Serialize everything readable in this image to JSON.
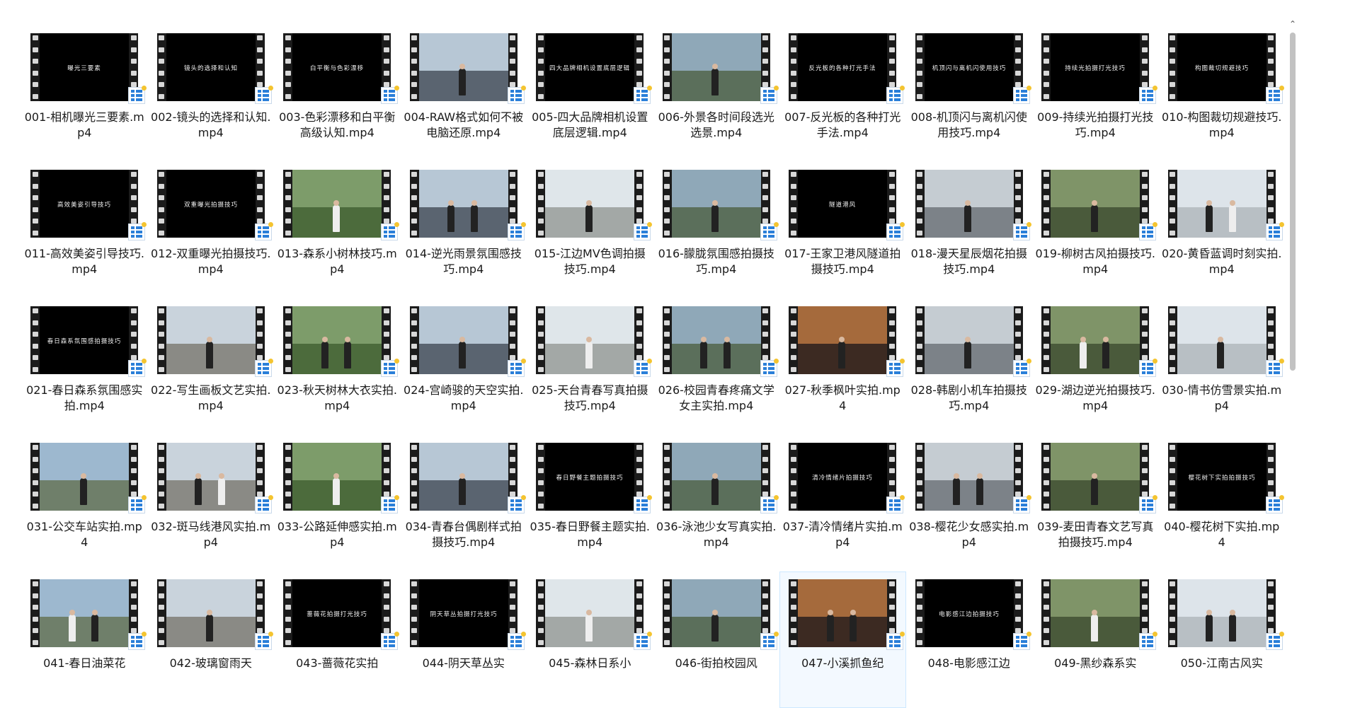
{
  "files": [
    {
      "name": "001-相机曝光三要素.mp4",
      "caption": "曝光三要素"
    },
    {
      "name": "002-镜头的选择和认知.mp4",
      "caption": "镜头的选择和认知"
    },
    {
      "name": "003-色彩漂移和白平衡高级认知.mp4",
      "caption": "白平衡与色彩漂移"
    },
    {
      "name": "004-RAW格式如何不被电脑还原.mp4",
      "caption": ""
    },
    {
      "name": "005-四大品牌相机设置底层逻辑.mp4",
      "caption": "四大品牌相机设置底层逻辑"
    },
    {
      "name": "006-外景各时间段选光选景.mp4",
      "caption": ""
    },
    {
      "name": "007-反光板的各种打光手法.mp4",
      "caption": "反光板的各种打光手法"
    },
    {
      "name": "008-机顶闪与离机闪使用技巧.mp4",
      "caption": "机顶闪与离机闪使用技巧"
    },
    {
      "name": "009-持续光拍摄打光技巧.mp4",
      "caption": "持续光拍摄打光技巧"
    },
    {
      "name": "010-构图裁切规避技巧.mp4",
      "caption": "构图裁切规避技巧"
    },
    {
      "name": "011-高效美姿引导技巧.mp4",
      "caption": "高效美姿引导技巧"
    },
    {
      "name": "012-双重曝光拍摄技巧.mp4",
      "caption": "双重曝光拍摄技巧"
    },
    {
      "name": "013-森系小树林技巧.mp4",
      "caption": ""
    },
    {
      "name": "014-逆光雨景氛围感技巧.mp4",
      "caption": ""
    },
    {
      "name": "015-江边MV色调拍摄技巧.mp4",
      "caption": ""
    },
    {
      "name": "016-朦胧氛围感拍摄技巧.mp4",
      "caption": ""
    },
    {
      "name": "017-王家卫港风隧道拍摄技巧.mp4",
      "caption": "隧道港风"
    },
    {
      "name": "018-漫天星辰烟花拍摄技巧.mp4",
      "caption": ""
    },
    {
      "name": "019-柳树古风拍摄技巧.mp4",
      "caption": ""
    },
    {
      "name": "020-黄昏蓝调时刻实拍.mp4",
      "caption": ""
    },
    {
      "name": "021-春日森系氛围感实拍.mp4",
      "caption": "春日森系氛围感拍摄技巧"
    },
    {
      "name": "022-写生画板文艺实拍.mp4",
      "caption": ""
    },
    {
      "name": "023-秋天树林大衣实拍.mp4",
      "caption": ""
    },
    {
      "name": "024-宫崎骏的天空实拍.mp4",
      "caption": ""
    },
    {
      "name": "025-天台青春写真拍摄技巧.mp4",
      "caption": ""
    },
    {
      "name": "026-校园青春疼痛文学女主实拍.mp4",
      "caption": ""
    },
    {
      "name": "027-秋季枫叶实拍.mp4",
      "caption": ""
    },
    {
      "name": "028-韩剧小机车拍摄技巧.mp4",
      "caption": ""
    },
    {
      "name": "029-湖边逆光拍摄技巧.mp4",
      "caption": ""
    },
    {
      "name": "030-情书仿雪景实拍.mp4",
      "caption": ""
    },
    {
      "name": "031-公交车站实拍.mp4",
      "caption": ""
    },
    {
      "name": "032-斑马线港风实拍.mp4",
      "caption": ""
    },
    {
      "name": "033-公路延伸感实拍.mp4",
      "caption": ""
    },
    {
      "name": "034-青春台偶剧样式拍摄技巧.mp4",
      "caption": ""
    },
    {
      "name": "035-春日野餐主题实拍.mp4",
      "caption": "春日野餐主题拍摄技巧"
    },
    {
      "name": "036-泳池少女写真实拍.mp4",
      "caption": ""
    },
    {
      "name": "037-清冷情绪片实拍.mp4",
      "caption": "清冷情绪片拍摄技巧"
    },
    {
      "name": "038-樱花少女感实拍.mp4",
      "caption": ""
    },
    {
      "name": "039-麦田青春文艺写真拍摄技巧.mp4",
      "caption": ""
    },
    {
      "name": "040-樱花树下实拍.mp4",
      "caption": "樱花树下实拍拍摄技巧"
    },
    {
      "name": "041-春日油菜花",
      "caption": ""
    },
    {
      "name": "042-玻璃窗雨天",
      "caption": ""
    },
    {
      "name": "043-蔷薇花实拍",
      "caption": "蔷薇花拍摄打光技巧"
    },
    {
      "name": "044-阴天草丛实",
      "caption": "阴天草丛拍摄打光技巧"
    },
    {
      "name": "045-森林日系小",
      "caption": ""
    },
    {
      "name": "046-街拍校园风",
      "caption": ""
    },
    {
      "name": "047-小溪抓鱼纪",
      "caption": ""
    },
    {
      "name": "048-电影感江边",
      "caption": "电影感江边拍摄技巧"
    },
    {
      "name": "049-黑纱森系实",
      "caption": ""
    },
    {
      "name": "050-江南古风实",
      "caption": ""
    }
  ],
  "selected_index": 46,
  "colors": {
    "file_icon_blue": "#2a7fd9",
    "file_icon_yellow": "#f4c430",
    "selection_border": "#cde8ff",
    "scroll_thumb": "#c2c2c2"
  },
  "icons": {
    "file_type": "video-file-icon",
    "scroll_up": "scroll-up-arrow-icon"
  }
}
